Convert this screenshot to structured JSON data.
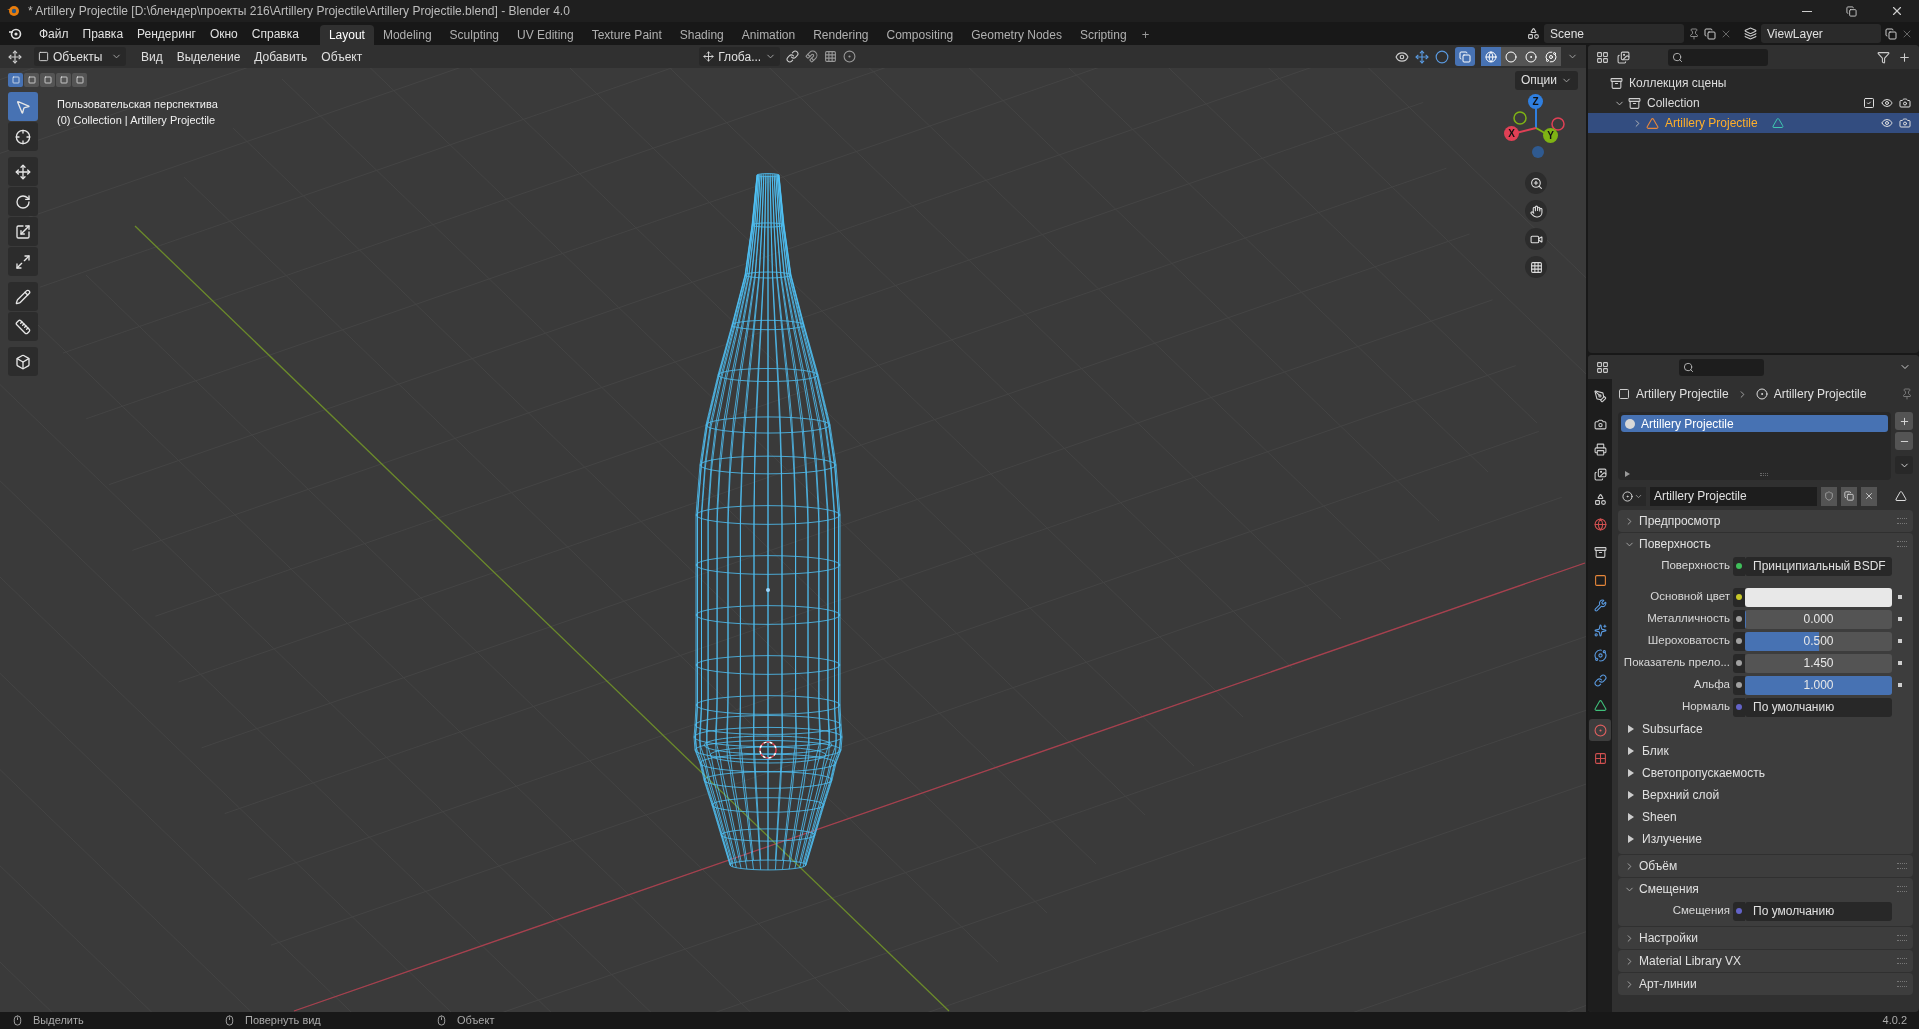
{
  "window": {
    "title": "* Artillery Projectile [D:\\блендер\\проекты 216\\Artillery Projectile\\Artillery Projectile.blend] - Blender 4.0"
  },
  "menu": [
    "Файл",
    "Правка",
    "Рендеринг",
    "Окно",
    "Справка"
  ],
  "workspaces": [
    {
      "label": "Layout",
      "selected": true
    },
    {
      "label": "Modeling",
      "selected": false
    },
    {
      "label": "Sculpting",
      "selected": false
    },
    {
      "label": "UV Editing",
      "selected": false
    },
    {
      "label": "Texture Paint",
      "selected": false
    },
    {
      "label": "Shading",
      "selected": false
    },
    {
      "label": "Animation",
      "selected": false
    },
    {
      "label": "Rendering",
      "selected": false
    },
    {
      "label": "Compositing",
      "selected": false
    },
    {
      "label": "Geometry Nodes",
      "selected": false
    },
    {
      "label": "Scripting",
      "selected": false
    }
  ],
  "add_workspace": "+",
  "scene": "Scene",
  "view_layer": "ViewLayer",
  "viewport": {
    "mode": "Объекты",
    "menus": [
      "Вид",
      "Выделение",
      "Добавить",
      "Объект"
    ],
    "orientation": "Глоба...",
    "options": "Опции",
    "selection_modes": [
      {
        "selected": true
      },
      {
        "selected": false
      },
      {
        "selected": false
      },
      {
        "selected": false
      },
      {
        "selected": false
      }
    ],
    "xray": true,
    "shading": [
      {
        "kind": "wireframe",
        "selected": true
      },
      {
        "kind": "solid",
        "selected": false
      },
      {
        "kind": "material",
        "selected": false
      },
      {
        "kind": "rendered",
        "selected": false
      }
    ],
    "info": [
      "Пользовательская перспектива",
      "(0) Collection | Artillery Projectile"
    ],
    "gizmo_axes": [
      {
        "label": "Z",
        "color": "#2f7fe0"
      },
      {
        "label": "X",
        "color": "#e04055"
      },
      {
        "label": "Y",
        "color": "#7fb314"
      }
    ],
    "tools": [
      {
        "kind": "select",
        "selected": true
      },
      {
        "kind": "cursor",
        "selected": false
      },
      {
        "kind": "move",
        "selected": false
      },
      {
        "kind": "rotate",
        "selected": false
      },
      {
        "kind": "scale",
        "selected": false
      },
      {
        "kind": "transform",
        "selected": false
      },
      {
        "kind": "annotate",
        "selected": false
      },
      {
        "kind": "measure",
        "selected": false
      },
      {
        "kind": "add_cube",
        "selected": false
      }
    ]
  },
  "outliner": {
    "items": [
      {
        "label": "Коллекция сцены",
        "kind": "scene_collection",
        "selected": false,
        "children": [
          {
            "label": "Collection",
            "kind": "collection",
            "expanded": true,
            "checked": true,
            "selected": false,
            "children": [
              {
                "label": "Artillery Projectile",
                "kind": "object",
                "expanded": false,
                "selected": true
              }
            ]
          }
        ]
      }
    ]
  },
  "properties": {
    "tabs": [
      {
        "kind": "tool",
        "selected": false
      },
      {
        "kind": "render",
        "selected": false
      },
      {
        "kind": "output",
        "selected": false
      },
      {
        "kind": "view_layer",
        "selected": false
      },
      {
        "kind": "scene",
        "selected": false
      },
      {
        "kind": "world",
        "selected": false
      },
      {
        "kind": "collection",
        "selected": false
      },
      {
        "kind": "object",
        "selected": false
      },
      {
        "kind": "modifiers",
        "selected": false
      },
      {
        "kind": "particles",
        "selected": false
      },
      {
        "kind": "physics",
        "selected": false
      },
      {
        "kind": "constraints",
        "selected": false
      },
      {
        "kind": "data",
        "selected": false
      },
      {
        "kind": "material",
        "selected": true
      },
      {
        "kind": "texture",
        "selected": false
      }
    ],
    "breadcrumb": [
      "Artillery Projectile",
      "Artillery Projectile"
    ],
    "slots": [
      {
        "name": "Artillery Projectile",
        "selected": true
      }
    ],
    "material": "Artillery Projectile",
    "panels": [
      {
        "title": "Предпросмотр",
        "expanded": false
      },
      {
        "title": "Поверхность",
        "expanded": true,
        "fields": [
          {
            "label": "Поверхность",
            "kind": "link",
            "value": "Принципиальный BSDF",
            "color": "#3fbf5a"
          },
          {
            "label": "Основной цвет",
            "kind": "swatch",
            "color": "#c7c729"
          },
          {
            "label": "Металличность",
            "kind": "slider",
            "value": "0.000",
            "level": 0,
            "color": "#a1a1a1"
          },
          {
            "label": "Шероховатость",
            "kind": "slider",
            "value": "0.500",
            "level": 0.5,
            "color": "#a1a1a1"
          },
          {
            "label": "Показатель прело...",
            "kind": "number",
            "value": "1.450",
            "color": "#a1a1a1"
          },
          {
            "label": "Альфа",
            "kind": "slider",
            "value": "1.000",
            "level": 1,
            "color": "#a1a1a1"
          },
          {
            "label": "Нормаль",
            "kind": "link",
            "value": "По умолчанию",
            "color": "#6363c7"
          }
        ],
        "subpanels": [
          "Subsurface",
          "Блик",
          "Светопропускаемость",
          "Верхний слой",
          "Sheen",
          "Излучение"
        ]
      },
      {
        "title": "Объём",
        "expanded": false
      },
      {
        "title": "Смещения",
        "expanded": true,
        "fields": [
          {
            "label": "Смещения",
            "kind": "link",
            "value": "По умолчанию",
            "color": "#6363c7"
          }
        ]
      },
      {
        "title": "Настройки",
        "expanded": false
      },
      {
        "title": "Material Library VX",
        "expanded": false
      },
      {
        "title": "Арт-линии",
        "expanded": false
      }
    ]
  },
  "status_bar": {
    "hints": [
      "Выделить",
      "Повернуть вид",
      "Объект"
    ],
    "version": "4.0.2"
  }
}
